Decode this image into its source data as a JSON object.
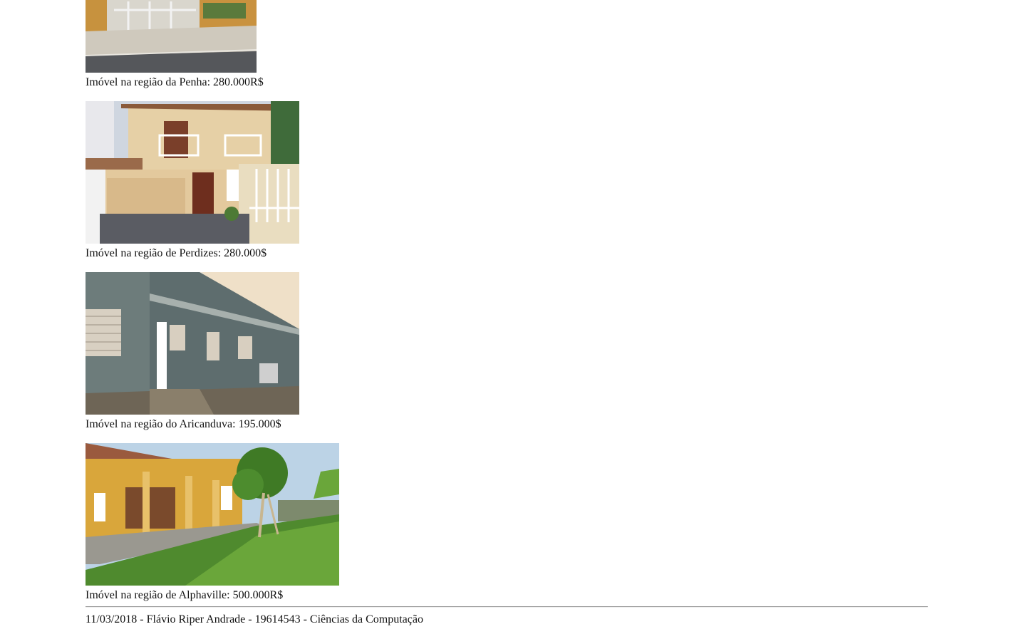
{
  "listings": [
    {
      "caption": "Imóvel na região da Penha: 280.000R$"
    },
    {
      "caption": "Imóvel na região de Perdizes: 280.000$"
    },
    {
      "caption": "Imóvel na região do Aricanduva: 195.000$"
    },
    {
      "caption": "Imóvel na região de Alphaville: 500.000R$"
    }
  ],
  "footer": {
    "text": "11/03/2018 - Flávio Riper Andrade - 19614543 - Ciências da Computação"
  }
}
